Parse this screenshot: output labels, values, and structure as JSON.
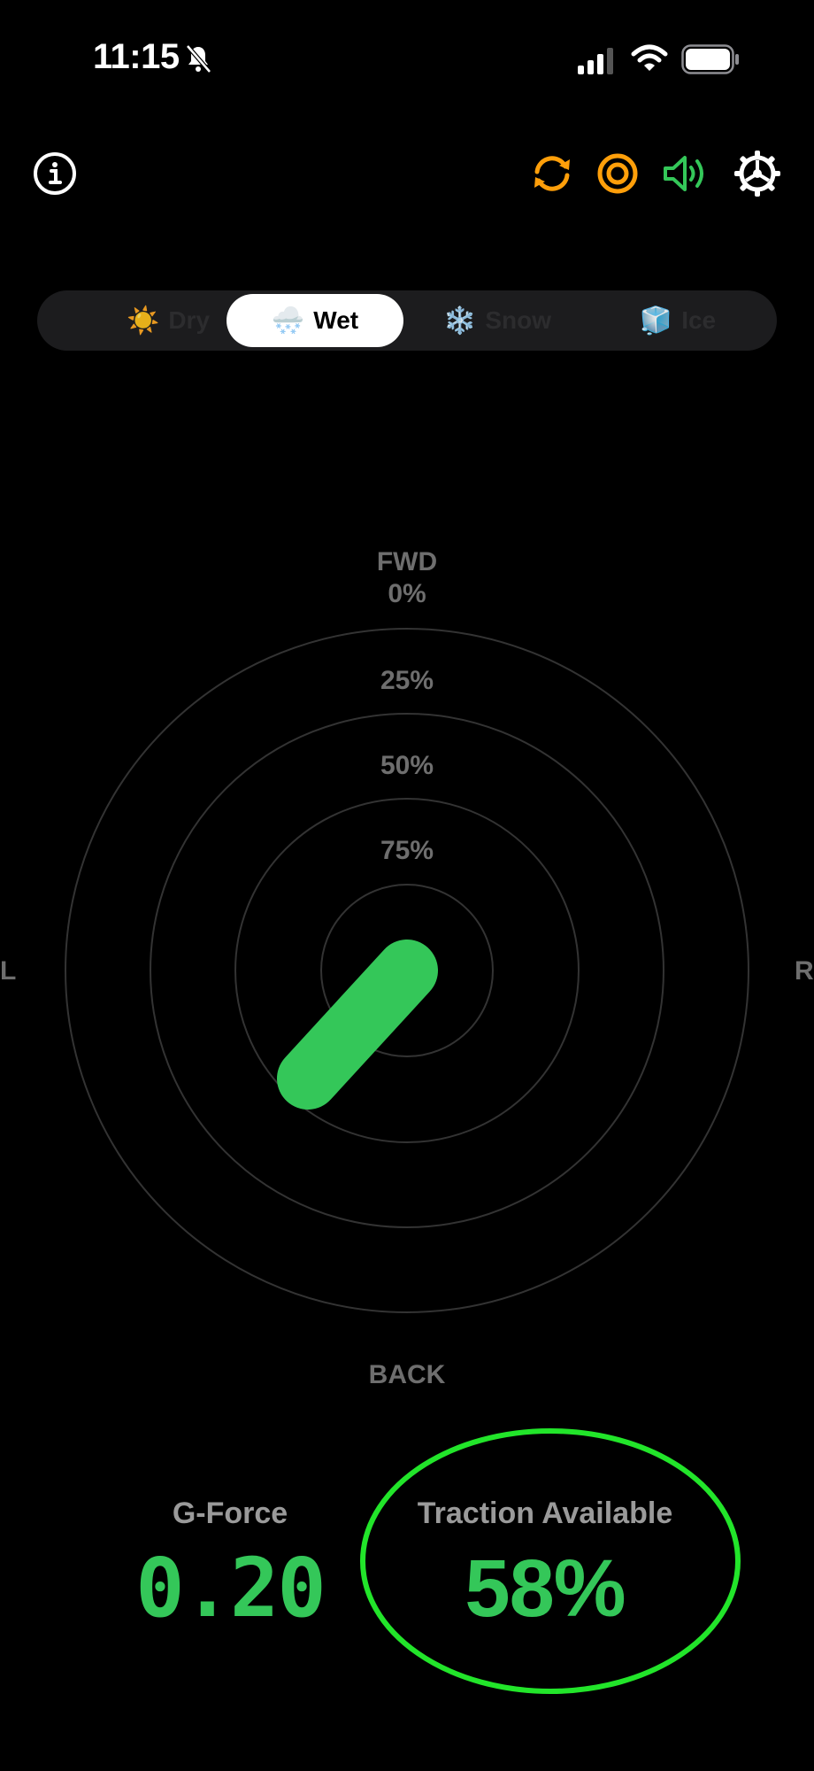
{
  "status_bar": {
    "time": "11:15",
    "icons": [
      "bell-slash-icon",
      "cellular-signal-icon",
      "wifi-icon",
      "battery-icon"
    ]
  },
  "toolbar": {
    "left_icon": "info-icon",
    "right_icons": [
      "refresh-icon",
      "target-icon",
      "speaker-icon",
      "gear-icon"
    ],
    "accent_orange": "#ff9f0a",
    "accent_green": "#34c759"
  },
  "surface_selector": {
    "options": [
      {
        "emoji": "☀️",
        "label": "Dry"
      },
      {
        "emoji": "🌨️",
        "label": "Wet"
      },
      {
        "emoji": "❄️",
        "label": "Snow"
      },
      {
        "emoji": "🧊",
        "label": "Ice"
      }
    ],
    "selected": "Wet"
  },
  "radar": {
    "top_label": "FWD",
    "top_pct": "0%",
    "ring_labels": [
      "25%",
      "50%",
      "75%"
    ],
    "bottom_label": "BACK",
    "left_label": "L",
    "right_label": "R",
    "vector_color": "#34c759"
  },
  "stats": {
    "gforce_title": "G-Force",
    "gforce_value": "0.20",
    "traction_title": "Traction Available",
    "traction_value": "58%",
    "highlight_color": "#22e52a"
  }
}
